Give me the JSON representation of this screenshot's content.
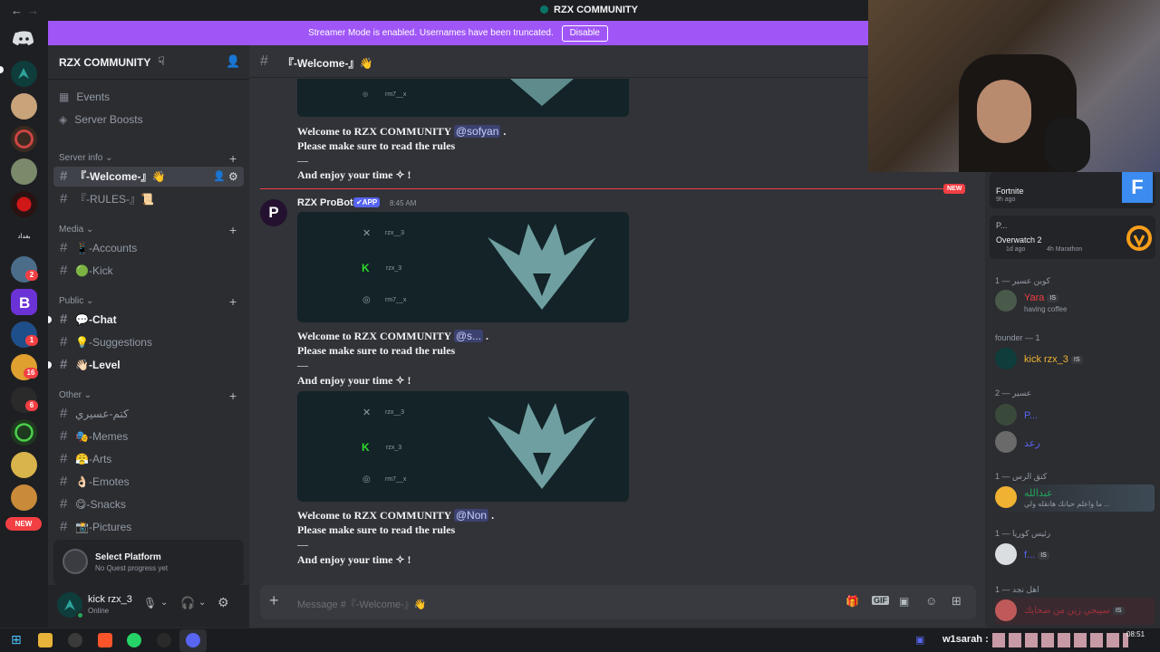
{
  "window": {
    "title": "RZX COMMUNITY",
    "back": "←",
    "forward": "→"
  },
  "banner": {
    "text": "Streamer Mode is enabled. Usernames have been truncated.",
    "button": "Disable"
  },
  "rail": {
    "badges": [
      "2",
      "1",
      "16",
      "6"
    ],
    "new_label": "NEW"
  },
  "sidebar": {
    "guild_name": "RZX COMMUNITY",
    "events": "Events",
    "boosts": "Server Boosts",
    "categories": [
      {
        "name": "Server info ⌄",
        "channels": [
          {
            "label": "『-Welcome-』👋"
          },
          {
            "label": "『-RULES-』📜"
          }
        ]
      },
      {
        "name": "Media ⌄",
        "channels": [
          {
            "label": "📱-Accounts"
          },
          {
            "label": "🟢-Kick"
          }
        ]
      },
      {
        "name": "Public ⌄",
        "channels": [
          {
            "label": "💬-Chat"
          },
          {
            "label": "💡-Suggestions"
          },
          {
            "label": "👋🏻-Level"
          }
        ]
      },
      {
        "name": "Other ⌄",
        "channels": [
          {
            "label": "كتم-عسيري"
          },
          {
            "label": "🎭-Memes"
          },
          {
            "label": "😤-Arts"
          },
          {
            "label": "👌🏻-Emotes"
          },
          {
            "label": "😋-Snacks"
          },
          {
            "label": "📸-Pictures"
          }
        ]
      }
    ],
    "quest": {
      "title": "Select Platform",
      "subtitle": "No Quest progress yet"
    },
    "user": {
      "name": "kick rzx_3",
      "status": "Online"
    }
  },
  "channel": {
    "name": "『-Welcome-』👋",
    "composer_placeholder": "Message #『-Welcome-』👋"
  },
  "embed": {
    "handles": [
      "rzx__3",
      "rzx_3",
      "rm7__x"
    ]
  },
  "messages": [
    {
      "welcome": "Welcome to RZX COMMUNITY",
      "mention": "@sofyan",
      "rules": "Please make sure to read the rules",
      "dash": "—",
      "enjoy": "And enjoy your time ✧ !"
    },
    {
      "welcome": "Welcome to RZX COMMUNITY",
      "mention": "@s...",
      "rules": "Please make sure to read the rules",
      "dash": "—",
      "enjoy": "And enjoy your time ✧ !"
    },
    {
      "welcome": "Welcome to RZX COMMUNITY",
      "mention": "@Non",
      "rules": "Please make sure to read the rules",
      "dash": "—",
      "enjoy": "And enjoy your time ✧ !"
    }
  ],
  "bot": {
    "name": "RZX ProBot",
    "badge": "✔APP",
    "time": "8:45 AM",
    "new_label": "NEW"
  },
  "activity": [
    {
      "game": "Fortnite",
      "when": "9h ago"
    },
    {
      "user": "P...",
      "game": "Overwatch 2",
      "when": "1d ago",
      "extra": "4h Marathon"
    }
  ],
  "members": [
    {
      "group": "كوين عسير — 1",
      "name": "Yara",
      "tag": "IS",
      "status": "having coffee"
    },
    {
      "group": "founder — 1",
      "name": "kick rzx_3",
      "tag": "IS"
    },
    {
      "group": "عسير — 2",
      "names": [
        "P...",
        "رعد"
      ]
    },
    {
      "group": "كنق الرس — 1",
      "name": "عبدالله",
      "status": "ما واعلم حيانك هانقله ولي ..."
    },
    {
      "group": "رئيس كوريا — 1",
      "name": "f...",
      "tag": "IS"
    },
    {
      "group": "اهل نجد — 1",
      "name": "سيبحي زين من ضحايك",
      "tag": "IS"
    }
  ],
  "taskbar": {
    "user": "w1sarah :",
    "time": "08:51"
  },
  "colors": {
    "accent": "#a056f7",
    "blurple": "#5865f2",
    "red": "#f23f43",
    "green": "#23a55a",
    "yellow": "#f0b232"
  }
}
